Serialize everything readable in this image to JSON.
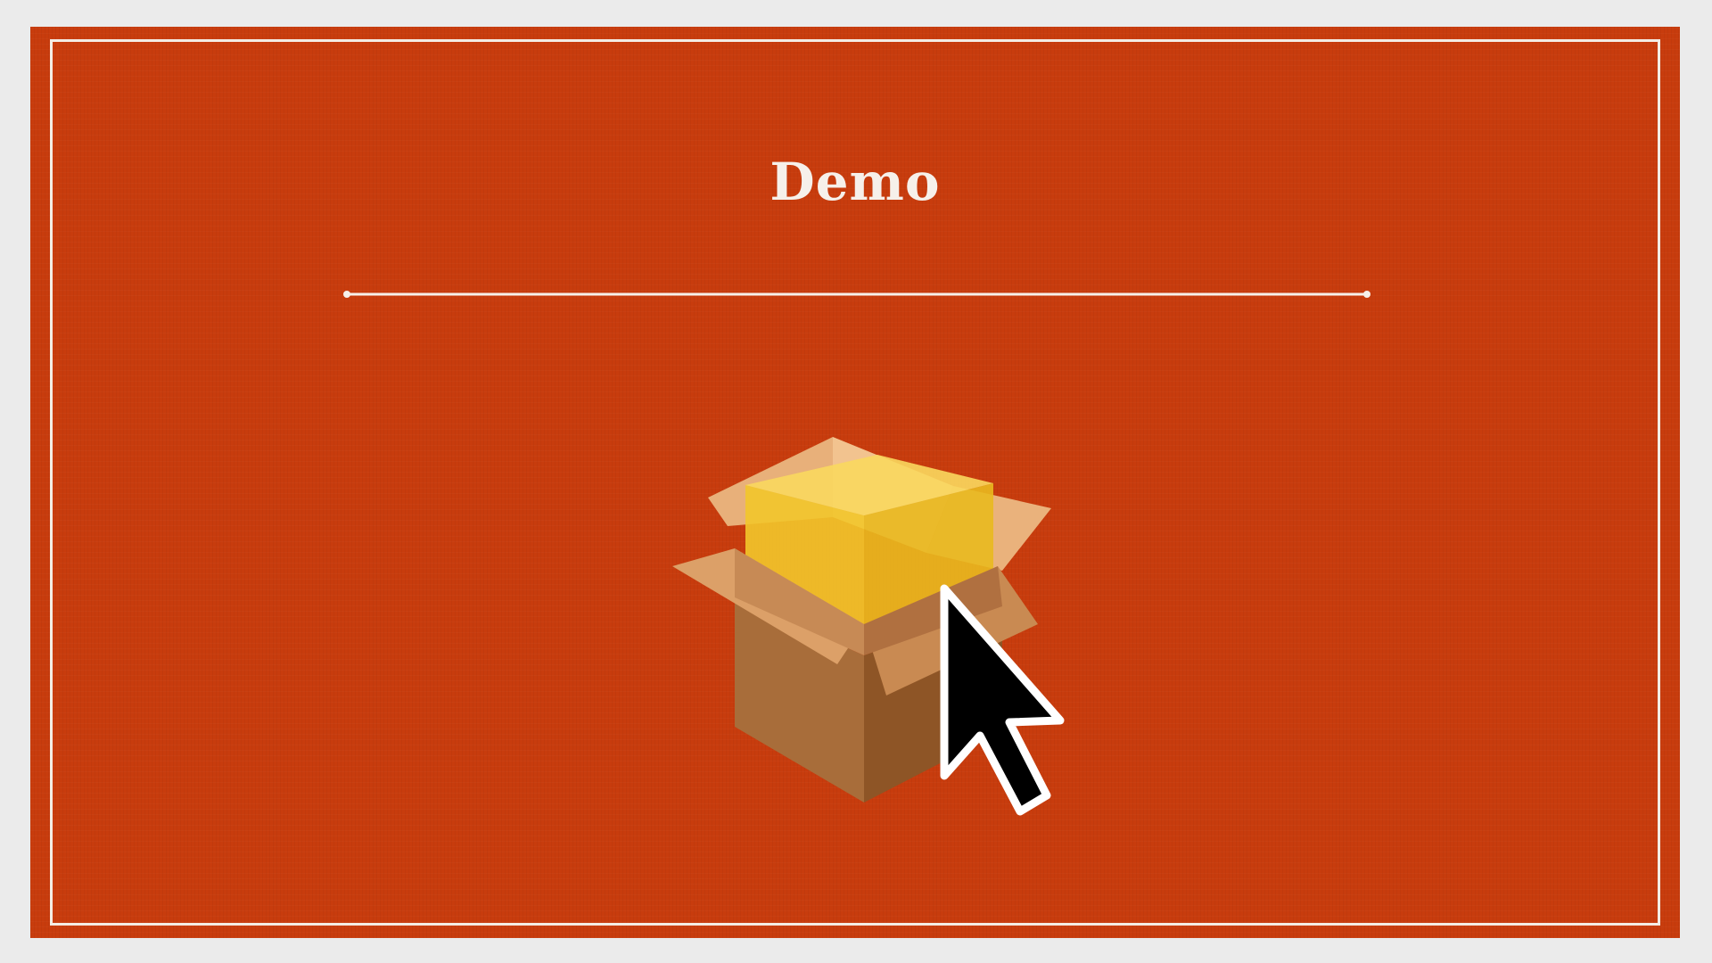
{
  "slide": {
    "title": "Demo",
    "background_color": "#c83c0d",
    "frame_color": "#f4ece4"
  },
  "illustration": {
    "icon": "package-installer-icon",
    "cursor": "mouse-pointer-icon"
  }
}
